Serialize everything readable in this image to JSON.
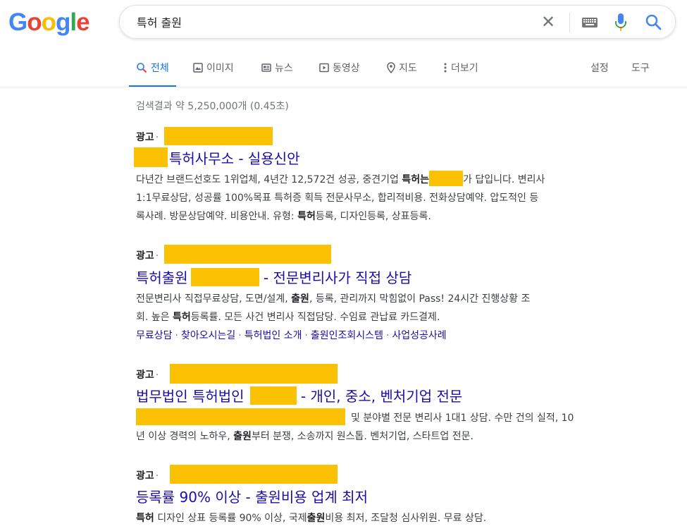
{
  "logo": {
    "letters": [
      "G",
      "o",
      "o",
      "g",
      "l",
      "e"
    ]
  },
  "search": {
    "query": "특허 출원"
  },
  "tabs": [
    {
      "label": "전체",
      "icon": "search-icon",
      "active": true
    },
    {
      "label": "이미지",
      "icon": "image-icon"
    },
    {
      "label": "뉴스",
      "icon": "news-icon"
    },
    {
      "label": "동영상",
      "icon": "video-icon"
    },
    {
      "label": "지도",
      "icon": "map-pin-icon"
    },
    {
      "label": "더보기",
      "icon": "more-vert-icon"
    }
  ],
  "tools": {
    "settings": "설정",
    "tools": "도구"
  },
  "stats": "검색결과 약 5,250,000개 (0.45초)",
  "results": [
    {
      "ad_label": "광고",
      "dot": "·",
      "title": "특허사무소 - 실용신안",
      "desc_line1_a": "다년간 브랜드선호도 1위업체, 4년간 12,572건 성공, 중견기업 ",
      "desc_line1_b": "특허",
      "desc_line1_c": "는",
      "desc_line1_d": "가 답입니다. 변리사",
      "desc_line2": "1:1무료상담, 성공률 100%목표 특허증 획득 전문사무소, 합리적비용. 전화상담예약. 압도적인 등",
      "desc_line3_a": "록사례. 방문상담예약. 비용안내. 유형: ",
      "desc_line3_b": "특허",
      "desc_line3_c": "등록, 디자인등록, 상표등록."
    },
    {
      "ad_label": "광고",
      "dot": "·",
      "title_a": "특허출원",
      "title_b": " - 전문변리사가 직접 상담",
      "desc_line1_a": "전문변리사 직접무료상담, 도면/설계, ",
      "desc_line1_b": "출원",
      "desc_line1_c": ", 등록, 관리까지 막힘없이 Pass! 24시간 진행상황 조",
      "desc_line2_a": "회. 높은 ",
      "desc_line2_b": "특허",
      "desc_line2_c": "등록률. 모든 사건 변리사 직접담당. 수임료 관납료 카드결제.",
      "sitelinks": [
        "무료상담",
        "찾아오시는길",
        "특허법인 소개",
        "출원인조회시스템",
        "사업성공사례"
      ]
    },
    {
      "ad_label": "광고",
      "dot": "·",
      "title_a": "법무법인 특허법인",
      "title_b": " - 개인, 중소, 벤처기업 전문",
      "desc_line1": "및 분야별 전문 변리사 1대1 상담. 수만 건의 실적, 10",
      "desc_line2_a": "년 이상 경력의 노하우, ",
      "desc_line2_b": "출원",
      "desc_line2_c": "부터 분쟁, 소송까지 원스톱. 벤처기업, 스타트업 전문."
    },
    {
      "ad_label": "광고",
      "dot": "·",
      "title": "등록률 90% 이상 - 출원비용 업계 최저",
      "desc_a": "특허",
      "desc_b": " 디자인 상표 등록률 90% 이상, 국제",
      "desc_c": "출원",
      "desc_d": "비용 최저, 조달청 심사위원. 무료 상담."
    }
  ],
  "colors": {
    "link": "#1a0dab",
    "redaction": "#fdc103",
    "accent": "#1a73e8"
  }
}
